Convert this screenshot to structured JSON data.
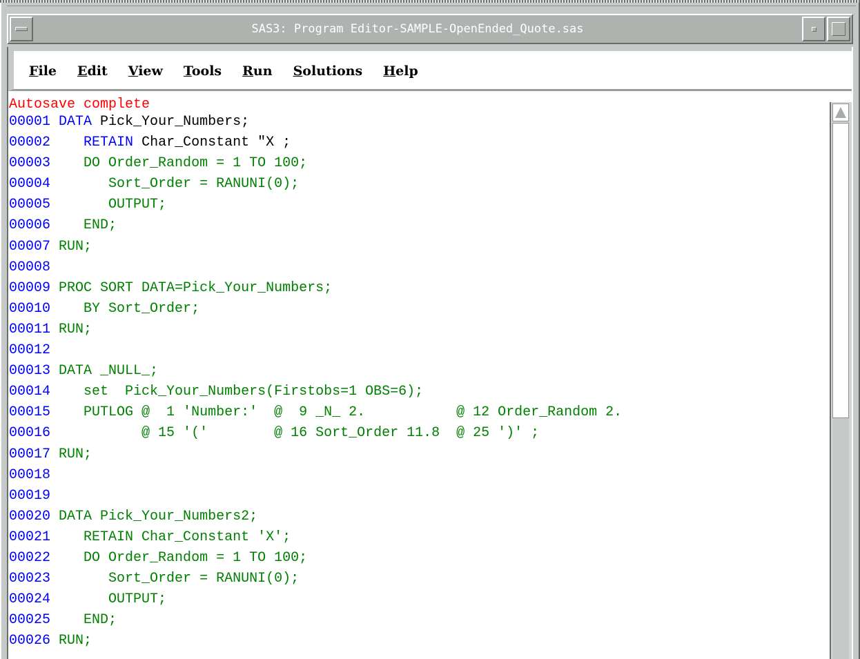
{
  "window": {
    "title": "SAS3: Program Editor-SAMPLE-OpenEnded_Quote.sas",
    "buttons": [
      "window-menu",
      "minimize",
      "maximize"
    ]
  },
  "menu": {
    "file_mn": "F",
    "file_rest": "ile",
    "edit_mn": "E",
    "edit_rest": "dit",
    "view_mn": "V",
    "view_rest": "iew",
    "tools_mn": "T",
    "tools_rest": "ools",
    "run_mn": "R",
    "run_rest": "un",
    "solutions_mn": "S",
    "solutions_rest": "olutions",
    "help_mn": "H",
    "help_rest": "elp"
  },
  "editor": {
    "status_message": "Autosave complete",
    "lines": [
      {
        "num": "00001",
        "kw": "DATA",
        "kw_text": " Pick_Your_Numbers;",
        "green": ""
      },
      {
        "num": "00002",
        "kw": "   RETAIN",
        "kw_text": " Char_Constant \"X ;",
        "green": ""
      },
      {
        "num": "00003",
        "kw": "",
        "kw_text": "",
        "green": "   DO Order_Random = 1 TO 100;"
      },
      {
        "num": "00004",
        "kw": "",
        "kw_text": "",
        "green": "      Sort_Order = RANUNI(0);"
      },
      {
        "num": "00005",
        "kw": "",
        "kw_text": "",
        "green": "      OUTPUT;"
      },
      {
        "num": "00006",
        "kw": "",
        "kw_text": "",
        "green": "   END;"
      },
      {
        "num": "00007",
        "kw": "",
        "kw_text": "",
        "green": "RUN;"
      },
      {
        "num": "00008",
        "kw": "",
        "kw_text": "",
        "green": ""
      },
      {
        "num": "00009",
        "kw": "",
        "kw_text": "",
        "green": "PROC SORT DATA=Pick_Your_Numbers;"
      },
      {
        "num": "00010",
        "kw": "",
        "kw_text": "",
        "green": "   BY Sort_Order;"
      },
      {
        "num": "00011",
        "kw": "",
        "kw_text": "",
        "green": "RUN;"
      },
      {
        "num": "00012",
        "kw": "",
        "kw_text": "",
        "green": ""
      },
      {
        "num": "00013",
        "kw": "",
        "kw_text": "",
        "green": "DATA _NULL_;"
      },
      {
        "num": "00014",
        "kw": "",
        "kw_text": "",
        "green": "   set  Pick_Your_Numbers(Firstobs=1 OBS=6);"
      },
      {
        "num": "00015",
        "kw": "",
        "kw_text": "",
        "green": "   PUTLOG @  1 'Number:'  @  9 _N_ 2.           @ 12 Order_Random 2."
      },
      {
        "num": "00016",
        "kw": "",
        "kw_text": "",
        "green": "          @ 15 '('        @ 16 Sort_Order 11.8  @ 25 ')' ;"
      },
      {
        "num": "00017",
        "kw": "",
        "kw_text": "",
        "green": "RUN;"
      },
      {
        "num": "00018",
        "kw": "",
        "kw_text": "",
        "green": ""
      },
      {
        "num": "00019",
        "kw": "",
        "kw_text": "",
        "green": ""
      },
      {
        "num": "00020",
        "kw": "",
        "kw_text": "",
        "green": "DATA Pick_Your_Numbers2;"
      },
      {
        "num": "00021",
        "kw": "",
        "kw_text": "",
        "green": "   RETAIN Char_Constant 'X';"
      },
      {
        "num": "00022",
        "kw": "",
        "kw_text": "",
        "green": "   DO Order_Random = 1 TO 100;"
      },
      {
        "num": "00023",
        "kw": "",
        "kw_text": "",
        "green": "      Sort_Order = RANUNI(0);"
      },
      {
        "num": "00024",
        "kw": "",
        "kw_text": "",
        "green": "      OUTPUT;"
      },
      {
        "num": "00025",
        "kw": "",
        "kw_text": "",
        "green": "   END;"
      },
      {
        "num": "00026",
        "kw": "",
        "kw_text": "",
        "green": "RUN;"
      }
    ]
  }
}
